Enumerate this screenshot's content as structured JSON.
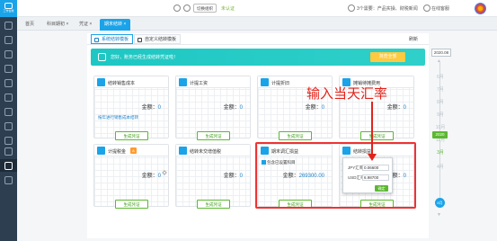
{
  "app": {
    "logo_text": "工作台账",
    "accent": "#1aa3e8",
    "annotation_color": "#e2231a"
  },
  "topbar": {
    "switch_org": "切换组织",
    "not_certified": "未认证",
    "messages": "3个需要：产品实操、财税新闻",
    "online_service": "在线客服"
  },
  "tabs": [
    {
      "label": "首页"
    },
    {
      "label": "科目期初 ×"
    },
    {
      "label": "凭证 ×"
    },
    {
      "label": "期末结转 ×"
    }
  ],
  "subtabs": [
    {
      "label": "系统结转模板"
    },
    {
      "label": "自定义结转模板"
    }
  ],
  "refresh_label": "刷新",
  "banner": {
    "text": "您好，账务已经生成结转凭证啦！",
    "button": "浏览全部"
  },
  "amount_label": "金额：",
  "generate_label": "生成凭证",
  "cards": [
    {
      "title": "结转销售成本",
      "amount": "0",
      "link": "按年进行销售成本结转"
    },
    {
      "title": "计提工资",
      "amount": "0"
    },
    {
      "title": "计提折旧",
      "amount": "0"
    },
    {
      "title": "摊销待摊费用",
      "amount": "0"
    },
    {
      "title": "计提税金",
      "amount": "0",
      "badge": "A"
    },
    {
      "title": "结转未交增值税",
      "amount": "0"
    },
    {
      "title": "期末调汇损益",
      "amount": "269300.00",
      "check": "包含已设置科目"
    },
    {
      "title": "结转损益",
      "amount": "0"
    }
  ],
  "fx_popup": {
    "rows": [
      {
        "label": "JPY汇率：",
        "value": "0.06600"
      },
      {
        "label": "USD汇率：",
        "value": "6.98700"
      }
    ],
    "ok_label": "确定"
  },
  "annotation_text": "输入当天汇率",
  "monthbar": {
    "year": "2020.08",
    "months": [
      "6月",
      "7月",
      "8月",
      "9月",
      "10月",
      "11月"
    ],
    "highlight_month": "3月",
    "current_badge": "2020",
    "current_month": "4月",
    "dot_label": "8月"
  }
}
